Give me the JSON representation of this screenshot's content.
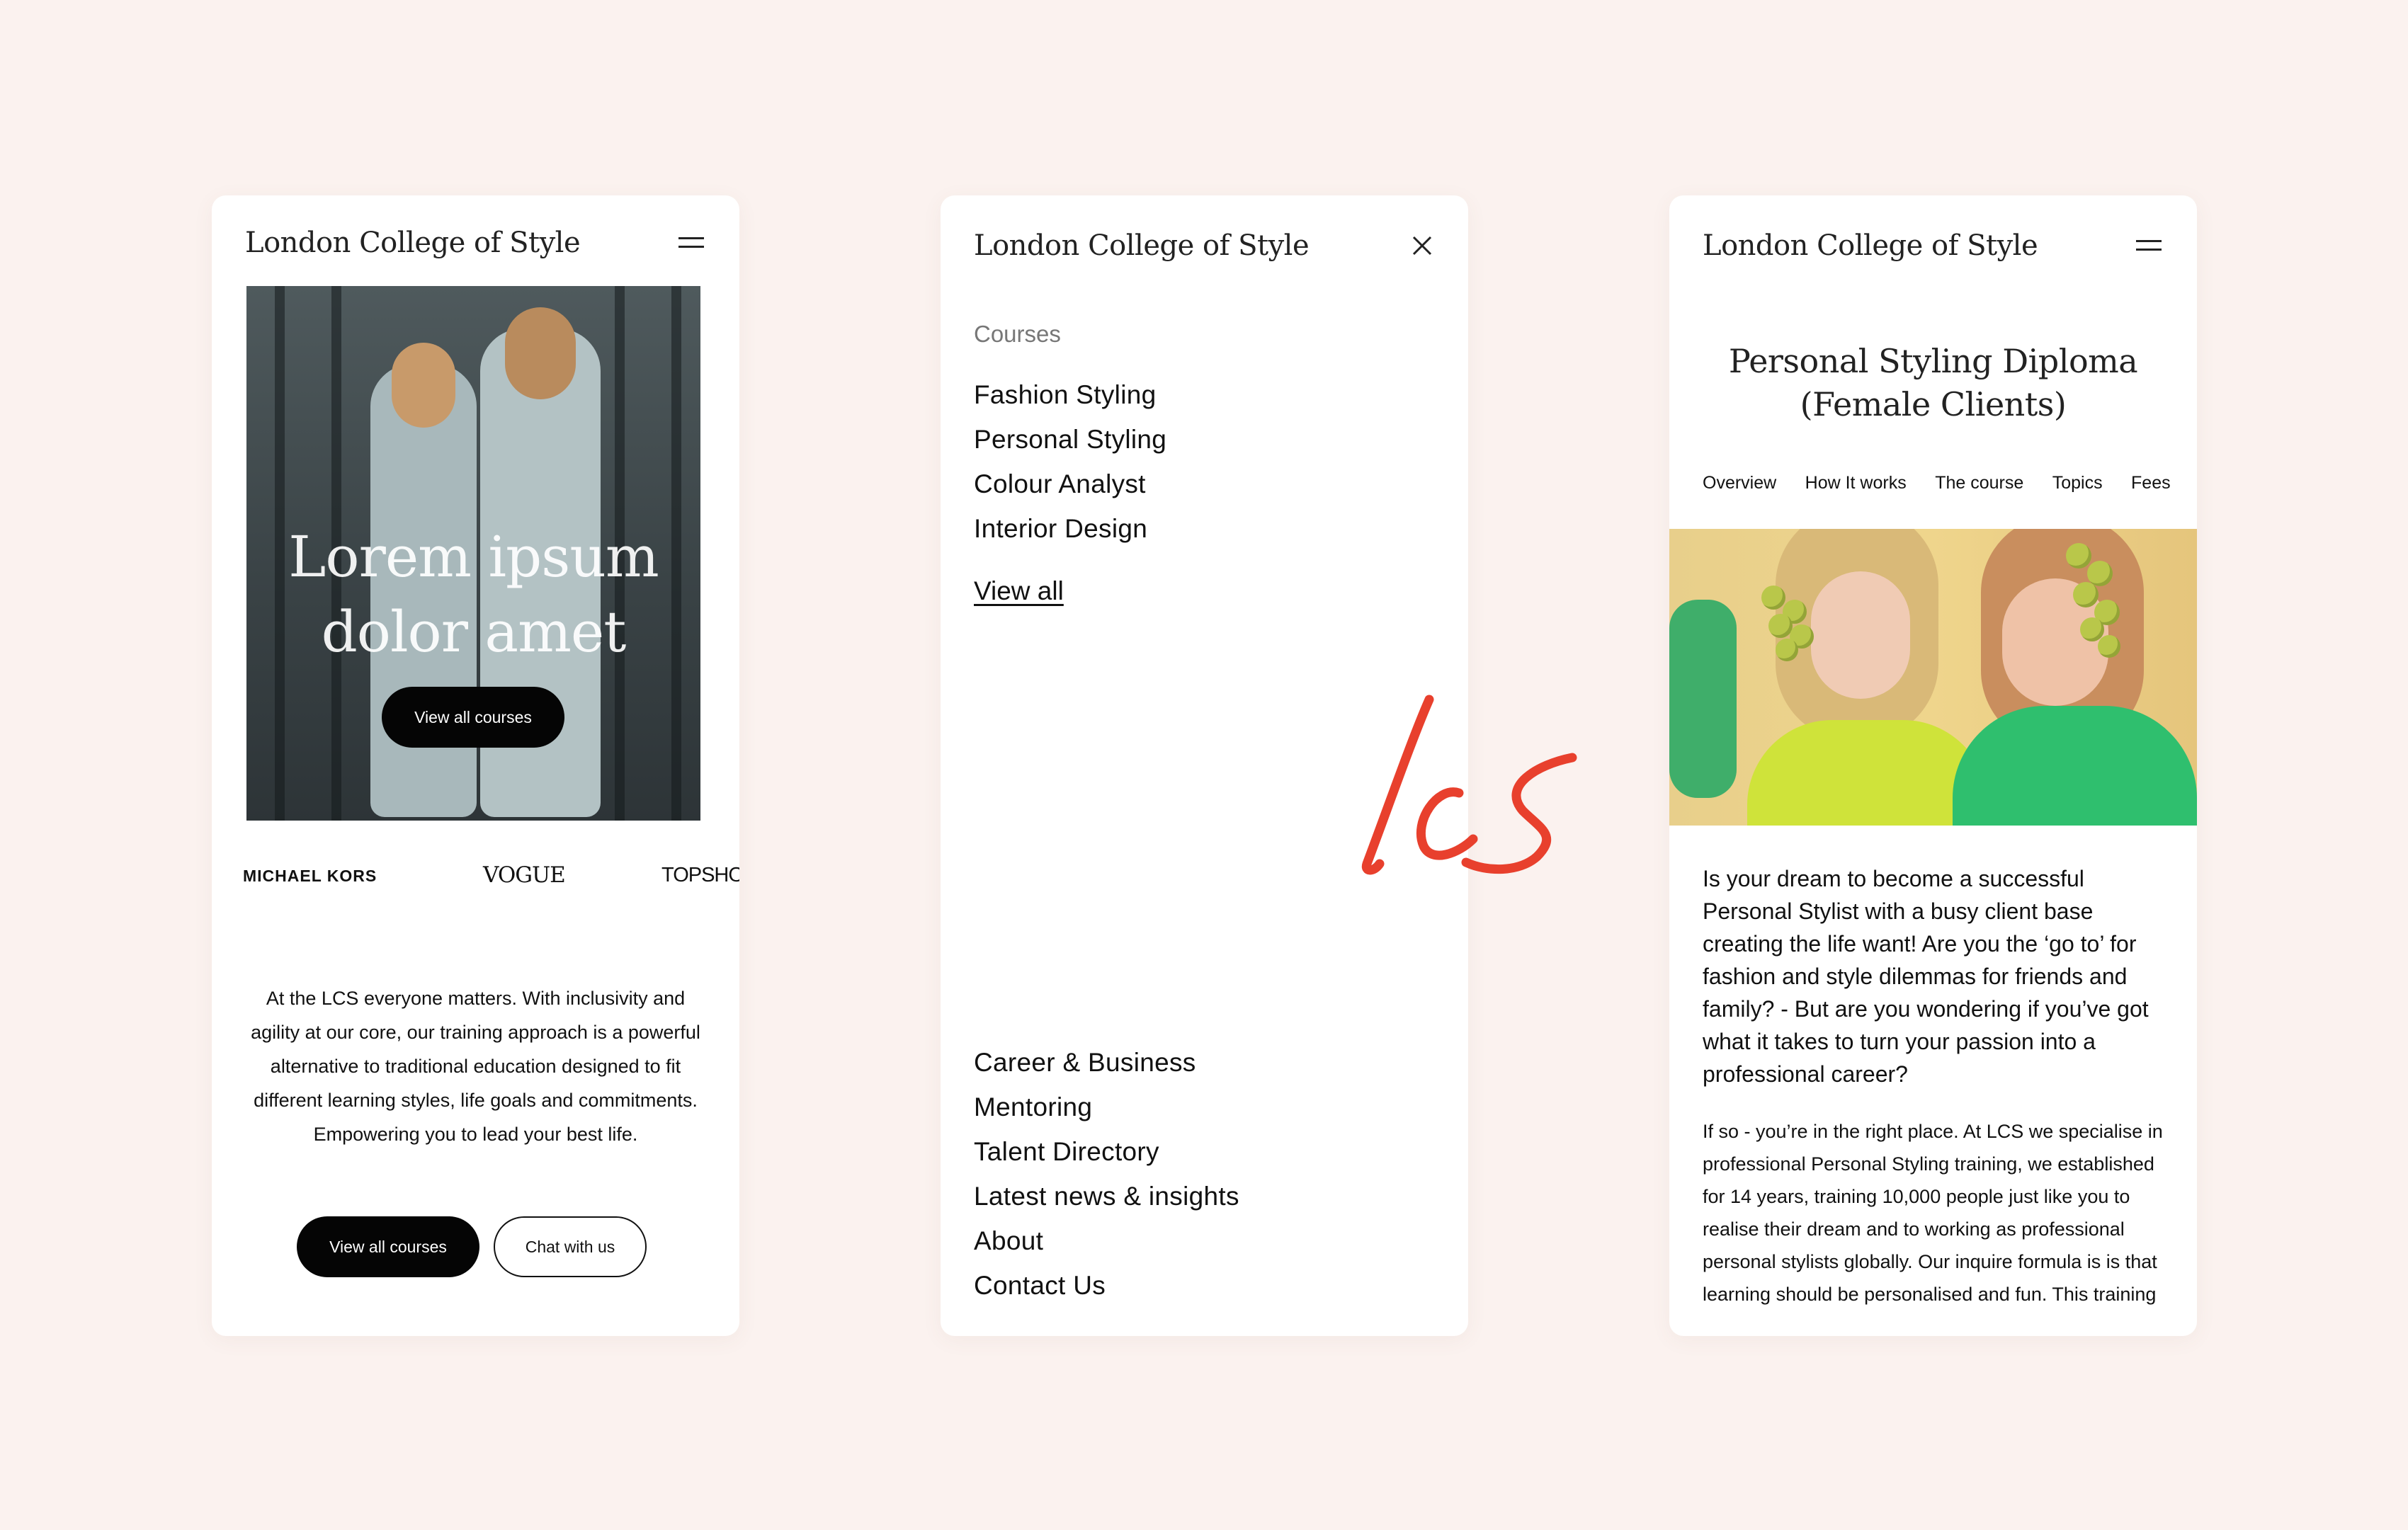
{
  "brand": {
    "accent": "#e8402d",
    "background": "#fbf2ef"
  },
  "logo_mark": {
    "text": "lcs",
    "icon": "lcs-script-logo"
  },
  "home": {
    "logo": "London College of Style",
    "hero_title": "Lorem ipsum dolor amet",
    "hero_button": "View all courses",
    "brands": [
      "MICHAEL KORS",
      "VOGUE",
      "TOPSHO"
    ],
    "intro": "At the LCS everyone matters. With inclusivity and agility at our core, our training approach is a powerful alternative to traditional education designed to fit different learning styles, life goals and commitments. Empowering you to lead your best life.",
    "primary_button": "View all courses",
    "secondary_button": "Chat with us"
  },
  "menu": {
    "logo": "London College of Style",
    "courses_heading": "Courses",
    "courses": [
      "Fashion Styling",
      "Personal Styling",
      "Colour Analyst",
      "Interior Design"
    ],
    "view_all": "View all",
    "links": [
      "Career & Business",
      "Mentoring",
      "Talent Directory",
      "Latest news & insights",
      "About",
      "Contact Us"
    ]
  },
  "course": {
    "logo": "London College of Style",
    "title": "Personal Styling Diploma (Female Clients)",
    "tabs": [
      "Overview",
      "How It works",
      "The course",
      "Topics",
      "Fees"
    ],
    "lead": "Is your dream to become a successful Personal Stylist with a busy client base creating the life want! Are you the ‘go to’ for fashion and style dilemmas for friends and family? - But are you wondering if you’ve got what it takes to turn your passion into a professional career?",
    "body": "If so - you’re in the right place. At LCS we specialise in professional Personal Styling training, we established for 14 years, training 10,000 people just like you to realise their dream and to working as professional personal stylists globally. Our inquire formula is is that learning should be personalised and fun. This training"
  }
}
